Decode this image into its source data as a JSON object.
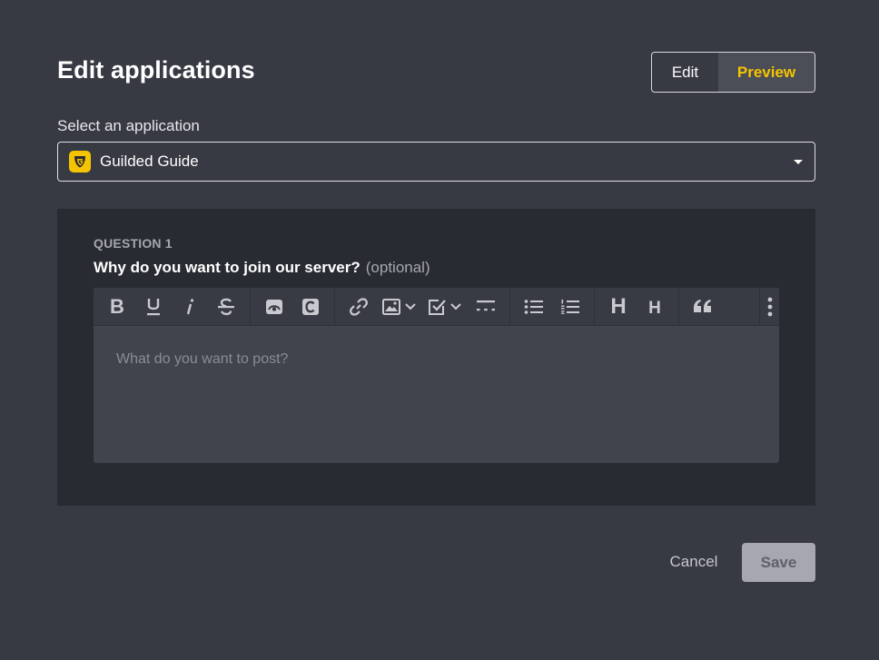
{
  "modal": {
    "title": "Edit applications",
    "mode_toggle": {
      "edit": "Edit",
      "preview": "Preview",
      "active": "Preview"
    },
    "select": {
      "label": "Select an application",
      "value": "Guilded Guide",
      "icon": "guilded-logo-icon"
    },
    "question": {
      "number_label": "QUESTION 1",
      "text": "Why do you want to join our server?",
      "optional_label": "(optional)"
    },
    "editor": {
      "placeholder": "What do you want to post?",
      "toolbar": {
        "bold": "B",
        "heading_large": "H",
        "heading_small": "H"
      }
    },
    "footer": {
      "cancel": "Cancel",
      "save": "Save"
    }
  },
  "colors": {
    "background": "#373943",
    "panel": "#292b32",
    "accent": "#f5c400",
    "save_disabled": "#a6a7b0"
  }
}
